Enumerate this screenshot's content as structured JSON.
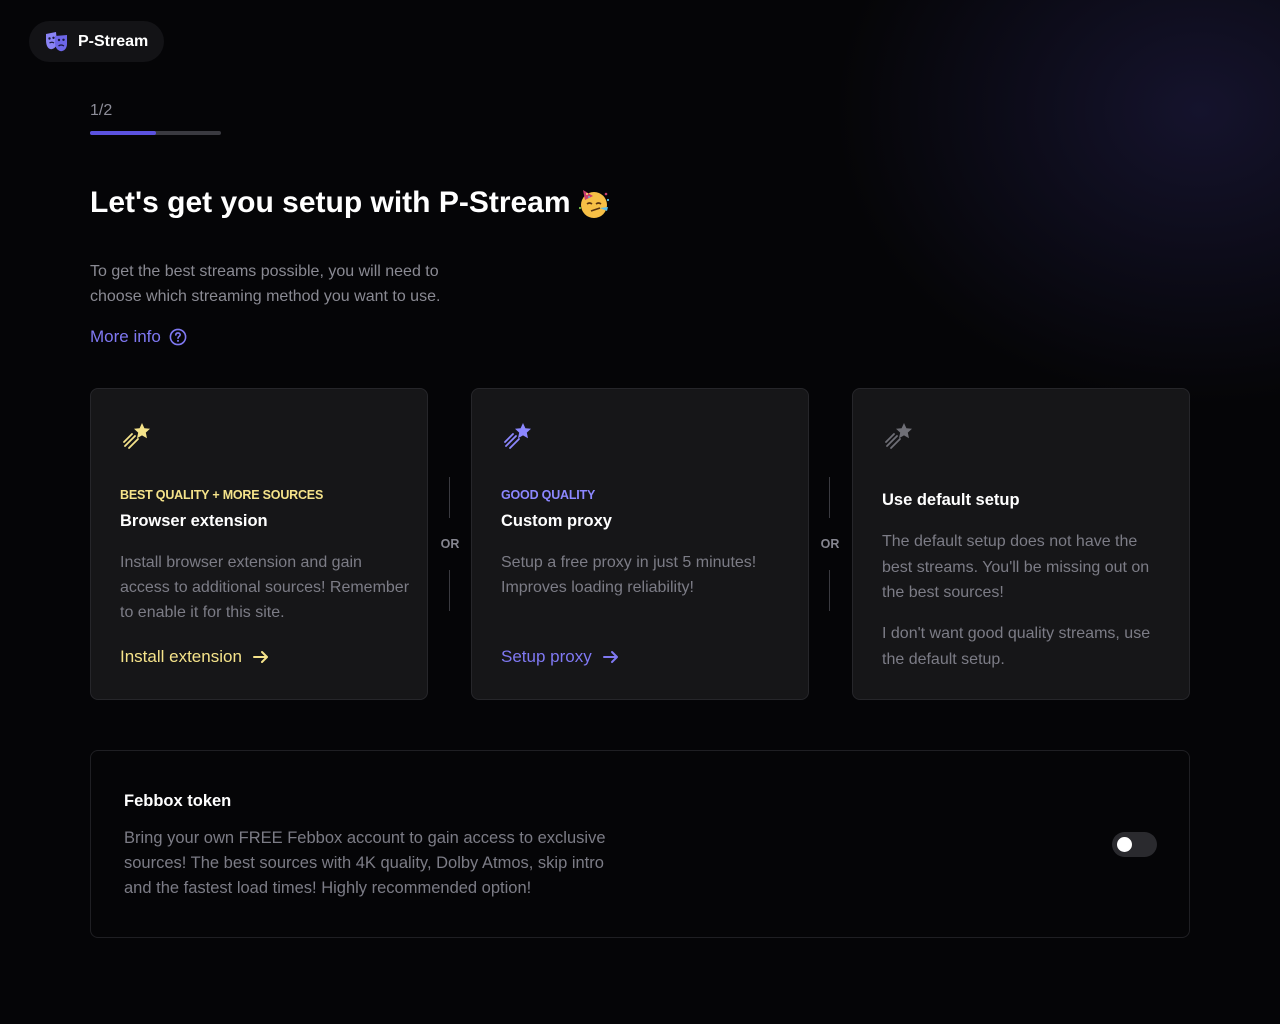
{
  "brand": {
    "name": "P-Stream",
    "icon": "theater-masks-icon"
  },
  "progress": {
    "step_text": "1/2",
    "fraction": 0.5
  },
  "heading": {
    "title": "Let's get you setup with P-Stream",
    "emoji": "partying-face"
  },
  "intro": {
    "text": "To get the best streams possible, you will need to choose which streaming method you want to use.",
    "more_info": "More info"
  },
  "separator": {
    "text": "OR"
  },
  "cards": {
    "extension": {
      "icon": "shooting-star-icon",
      "tag": "BEST QUALITY + MORE SOURCES",
      "tag_color": "#f5e38a",
      "title": "Browser extension",
      "description": "Install browser extension and gain access to additional sources! Remember to enable it for this site.",
      "link": "Install extension"
    },
    "proxy": {
      "icon": "shooting-star-icon",
      "tag": "GOOD QUALITY",
      "tag_color": "#8c87ff",
      "title": "Custom proxy",
      "description": "Setup a free proxy in just 5 minutes! Improves loading reliability!",
      "link": "Setup proxy"
    },
    "default": {
      "icon": "shooting-star-icon",
      "title": "Use default setup",
      "description": "The default setup does not have the best streams. You'll be missing out on the best sources!",
      "action": "I don't want good quality streams, use the default setup."
    }
  },
  "febbox": {
    "title": "Febbox token",
    "description": "Bring your own FREE Febbox account to gain access to exclusive sources! The best sources with 4K quality, Dolby Atmos, skip intro and the fastest load times! Highly recommended option!",
    "toggle_on": false
  },
  "colors": {
    "accent": "#5b52e0",
    "link": "#7f78f2",
    "extension": "#f5e38a",
    "background": "#050507",
    "card": "#161618"
  }
}
